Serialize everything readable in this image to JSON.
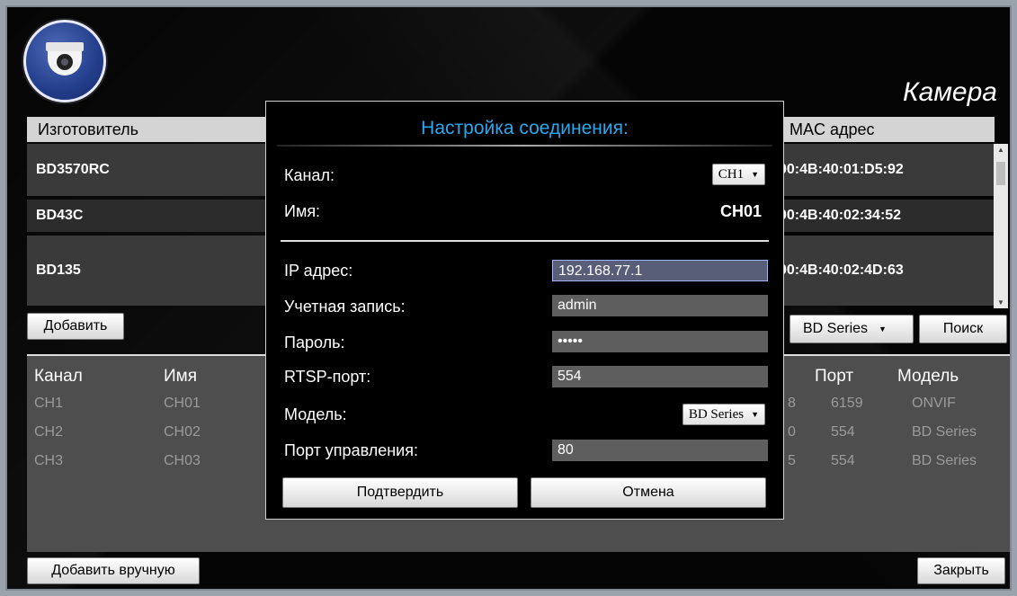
{
  "app_title": "Камера",
  "top_table": {
    "headers": {
      "manufacturer": "Изготовитель",
      "mac": "MAC адрес"
    },
    "rows": [
      {
        "name": "BD3570RC",
        "mac": "00:4B:40:01:D5:92"
      },
      {
        "name": "BD43C",
        "mac": "00:4B:40:02:34:52"
      },
      {
        "name": "BD135",
        "mac": "00:4B:40:02:4D:63"
      }
    ]
  },
  "toolbar": {
    "add_label": "Добавить",
    "series_select": "BD Series",
    "search_label": "Поиск"
  },
  "bottom_table": {
    "headers": {
      "channel": "Канал",
      "name": "Имя",
      "port": "Порт",
      "model": "Модель"
    },
    "rows": [
      {
        "channel": "CH1",
        "name": "CH01",
        "ipsuffix": "8",
        "port": "6159",
        "model": "ONVIF"
      },
      {
        "channel": "CH2",
        "name": "CH02",
        "ipsuffix": "0",
        "port": "554",
        "model": "BD Series"
      },
      {
        "channel": "CH3",
        "name": "CH03",
        "ipsuffix": "5",
        "port": "554",
        "model": "BD Series"
      }
    ]
  },
  "footer": {
    "manual_add_label": "Добавить вручную",
    "close_label": "Закрыть"
  },
  "dialog": {
    "title": "Настройка соединения:",
    "channel_label": "Канал:",
    "channel_value": "CH1",
    "name_label": "Имя:",
    "name_value": "CH01",
    "ip_label": "IP адрес:",
    "ip_value": "192.168.77.1",
    "account_label": "Учетная запись:",
    "account_value": "admin",
    "password_label": "Пароль:",
    "password_value": "•••••",
    "rtsp_label": "RTSP-порт:",
    "rtsp_value": "554",
    "model_label": "Модель:",
    "model_value": "BD Series",
    "control_port_label": "Порт управления:",
    "control_port_value": "80",
    "confirm_label": "Подтвердить",
    "cancel_label": "Отмена"
  }
}
